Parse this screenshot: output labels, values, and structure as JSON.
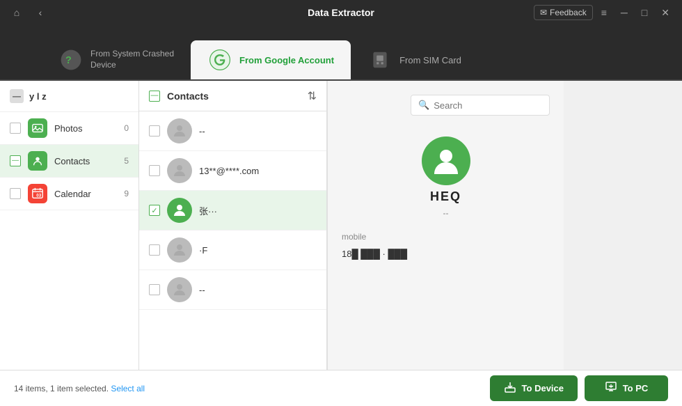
{
  "app": {
    "title": "Data Extractor",
    "feedback_label": "Feedback"
  },
  "titlebar": {
    "home_icon": "⌂",
    "back_icon": "‹",
    "menu_icon": "≡",
    "minimize_icon": "─",
    "maximize_icon": "□",
    "close_icon": "✕"
  },
  "tabs": [
    {
      "id": "crashed",
      "label": "From System Crashed\nDevice",
      "active": false
    },
    {
      "id": "google",
      "label": "From Google Account",
      "active": true
    },
    {
      "id": "sim",
      "label": "From SIM Card",
      "active": false
    }
  ],
  "sidebar": {
    "account": "y l z",
    "items": [
      {
        "id": "photos",
        "label": "Photos",
        "count": 0,
        "type": "photos",
        "checked": false,
        "partial": false
      },
      {
        "id": "contacts",
        "label": "Contacts",
        "count": 5,
        "type": "contacts",
        "checked": false,
        "partial": true
      },
      {
        "id": "calendar",
        "label": "Calendar",
        "count": 9,
        "type": "calendar",
        "checked": false,
        "partial": false
      }
    ]
  },
  "contacts_panel": {
    "header": "Contacts",
    "items": [
      {
        "id": 1,
        "name": "--",
        "checked": false,
        "selected": false,
        "has_photo": false
      },
      {
        "id": 2,
        "name": "13**@****.com",
        "checked": false,
        "selected": false,
        "has_photo": false
      },
      {
        "id": 3,
        "name": "张···",
        "checked": true,
        "selected": true,
        "has_photo": true
      },
      {
        "id": 4,
        "name": "·F",
        "checked": false,
        "selected": false,
        "has_photo": false
      },
      {
        "id": 5,
        "name": "--",
        "checked": false,
        "selected": false,
        "has_photo": false
      }
    ]
  },
  "detail": {
    "search_placeholder": "Search",
    "name": "HEQ",
    "subname": "--",
    "phone_label": "mobile",
    "phone": "18█ ███ · ███"
  },
  "footer": {
    "status_text": "14 items, 1 item selected.",
    "select_all_label": "Select all",
    "to_device_label": "To Device",
    "to_pc_label": "To PC"
  }
}
